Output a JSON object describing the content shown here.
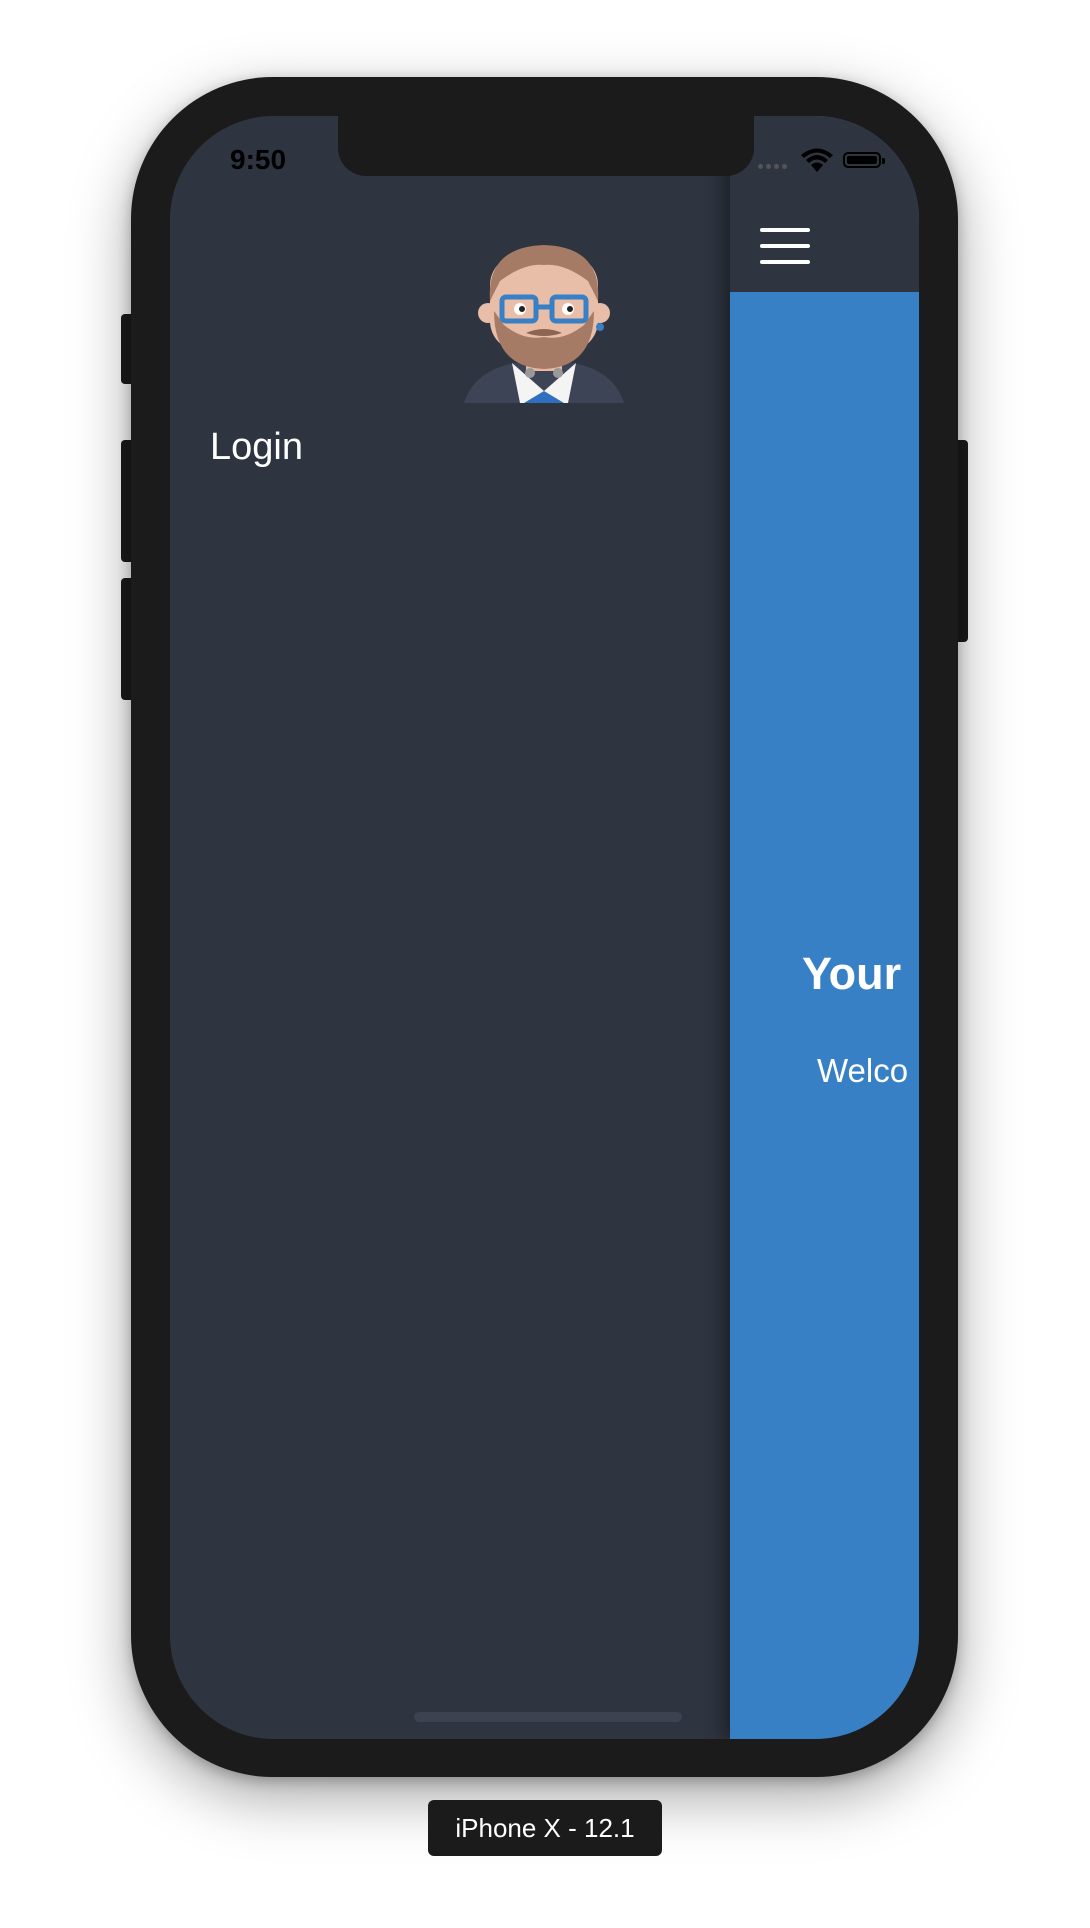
{
  "status_bar": {
    "time": "9:50"
  },
  "drawer": {
    "menu_items": [
      {
        "label": "Login"
      }
    ],
    "avatar_icon": "developer-avatar-illustration"
  },
  "main": {
    "menu_icon": "hamburger-menu-icon",
    "title": "Your",
    "welcome": "Welco"
  },
  "device_label": "iPhone X - 12.1",
  "colors": {
    "drawer_bg": "#2e3440",
    "main_bg": "#3880c6",
    "frame": "#1b1b1b"
  }
}
